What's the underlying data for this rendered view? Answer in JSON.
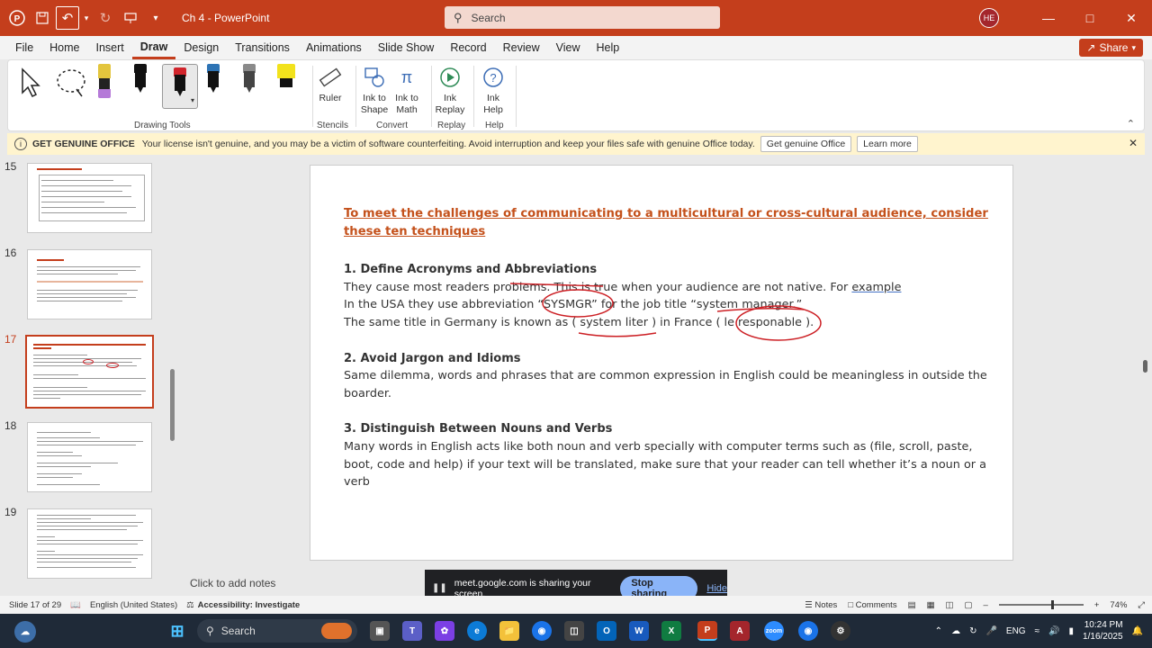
{
  "titlebar": {
    "doc_title": "Ch 4",
    "separator": "-",
    "app_name": "PowerPoint",
    "search_placeholder": "Search",
    "user_initials": "HE"
  },
  "menu": {
    "items": [
      "File",
      "Home",
      "Insert",
      "Draw",
      "Design",
      "Transitions",
      "Animations",
      "Slide Show",
      "Record",
      "Review",
      "View",
      "Help"
    ],
    "active": "Draw",
    "share_label": "Share"
  },
  "ribbon": {
    "groups": {
      "drawing_tools": "Drawing Tools",
      "stencils": "Stencils",
      "convert": "Convert",
      "replay": "Replay",
      "help": "Help"
    },
    "ruler": "Ruler",
    "ink_to_shape": "Ink to Shape",
    "ink_to_math": "Ink to Math",
    "ink_replay": "Ink Replay",
    "ink_help": "Ink Help",
    "pen_colors": [
      "#e3c53d",
      "#111111",
      "#d1242b",
      "#2e74b5",
      "#8a8a8a",
      "#f2e21c"
    ],
    "highlighter_left_color": "#b57ad8"
  },
  "notice": {
    "heading": "GET GENUINE OFFICE",
    "message": "Your license isn't genuine, and you may be a victim of software counterfeiting. Avoid interruption and keep your files safe with genuine Office today.",
    "btn_genuine": "Get genuine Office",
    "btn_learn": "Learn more"
  },
  "thumbnails": {
    "numbers": [
      "15",
      "16",
      "17",
      "18",
      "19"
    ],
    "active": "17"
  },
  "slide": {
    "title": "To meet the challenges of communicating to a multicultural or cross-cultural audience, consider these ten techniques",
    "sections": [
      {
        "heading": "1. Define Acronyms and Abbreviations",
        "line1_a": "They cause most readers problems. This is true when your audience are not native. For ",
        "line1_b": "example",
        "line2": "In the USA they use abbreviation “SYSMGR” for the job title “system manager.”",
        "line3": "The same title in Germany is known as ( system liter ) in France (  le responable )."
      },
      {
        "heading": "2. Avoid Jargon and Idioms",
        "body": "Same dilemma, words and phrases that are common expression in English could be meaningless in outside the boarder."
      },
      {
        "heading": "3. Distinguish Between Nouns and Verbs",
        "body": "Many words in English acts like both noun and verb specially with computer terms such as (file, scroll, paste, boot, code and help) if your text will be translated, make sure that your reader can tell whether it’s a noun or a verb"
      }
    ],
    "ink_color": "#cc1f24"
  },
  "notes_placeholder": "Click to add notes",
  "screenshare": {
    "message": "meet.google.com is sharing your screen.",
    "stop": "Stop sharing",
    "hide": "Hide"
  },
  "status": {
    "slide_info": "Slide 17 of 29",
    "language": "English (United States)",
    "accessibility": "Accessibility: Investigate",
    "notes": "Notes",
    "comments": "Comments",
    "zoom": "74%"
  },
  "taskbar": {
    "search": "Search",
    "lang": "ENG",
    "time": "10:24 PM",
    "date": "1/16/2025"
  }
}
